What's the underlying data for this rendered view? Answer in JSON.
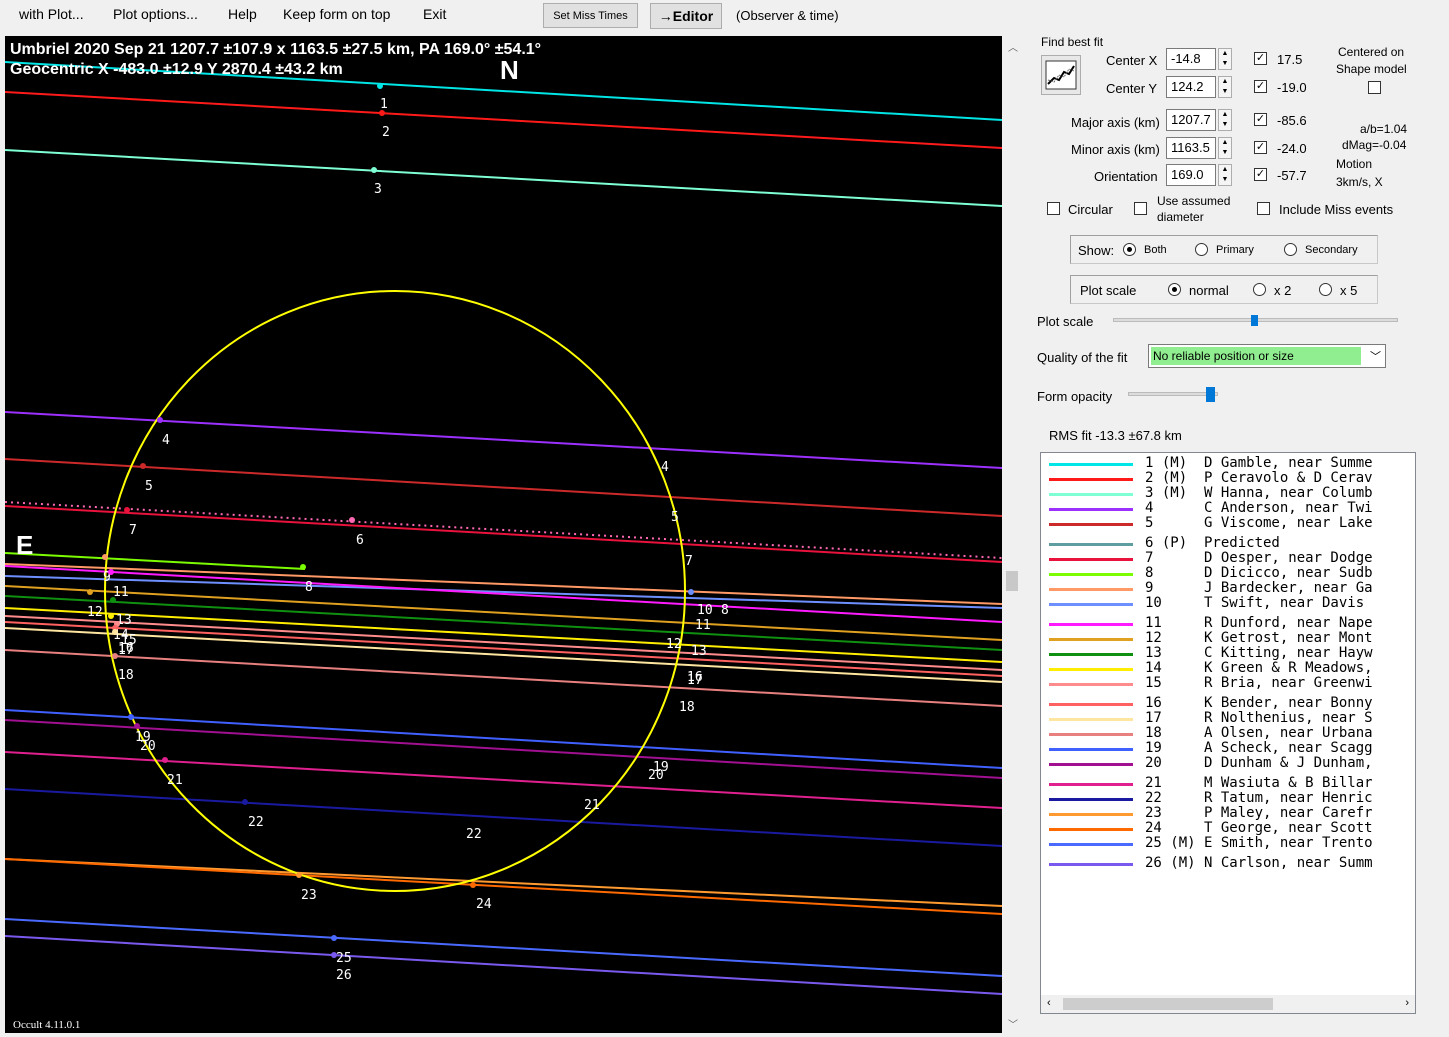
{
  "menu": {
    "with_plot": "with Plot...",
    "plot_options": "Plot options...",
    "help": "Help",
    "keep_on_top": "Keep form on top",
    "exit": "Exit",
    "set_miss_times": "Set Miss Times",
    "editor": "→Editor",
    "observer_time": "(Observer & time)"
  },
  "plot": {
    "title_line1": "Umbriel  2020 Sep 21   1207.7 ±107.9 x 1163.5 ±27.5 km, PA 169.0° ±54.1°",
    "title_line2": "Geocentric  X  -483.0 ±12.9  Y 2870.4 ±43.2 km",
    "north": "N",
    "east": "E",
    "version": "Occult 4.11.0.1",
    "ellipse_color": "#ffff00"
  },
  "chords": [
    {
      "n": "1",
      "color": "#00e5e5"
    },
    {
      "n": "2",
      "color": "#ff1a1a"
    },
    {
      "n": "3",
      "color": "#7fffd4"
    },
    {
      "n": "4",
      "color": "#9b30ff"
    },
    {
      "n": "5",
      "color": "#cc2a2a"
    },
    {
      "n": "6",
      "color": "#ff69b4"
    },
    {
      "n": "7",
      "color": "#e8123c"
    },
    {
      "n": "8",
      "color": "#7cfc00"
    },
    {
      "n": "9",
      "color": "#ff9966"
    },
    {
      "n": "10",
      "color": "#6e8fff"
    },
    {
      "n": "11",
      "color": "#ff1aff"
    },
    {
      "n": "12",
      "color": "#e0a020"
    },
    {
      "n": "13",
      "color": "#109010"
    },
    {
      "n": "14",
      "color": "#ffee00"
    },
    {
      "n": "15",
      "color": "#ff8c8c"
    },
    {
      "n": "16",
      "color": "#ff6060"
    },
    {
      "n": "17",
      "color": "#ffe6a0"
    },
    {
      "n": "18",
      "color": "#e88080"
    },
    {
      "n": "19",
      "color": "#4060ff"
    },
    {
      "n": "20",
      "color": "#a01090"
    },
    {
      "n": "21",
      "color": "#e0208f"
    },
    {
      "n": "22",
      "color": "#1a1aa0"
    },
    {
      "n": "23",
      "color": "#ff9a30"
    },
    {
      "n": "24",
      "color": "#ff6a00"
    },
    {
      "n": "25",
      "color": "#4a6aff"
    },
    {
      "n": "26",
      "color": "#7a5aee"
    }
  ],
  "panel": {
    "find_best_fit": "Find best fit",
    "center_x_label": "Center X",
    "center_x": "-14.8",
    "center_y_label": "Center Y",
    "center_y": "124.2",
    "major_label": "Major axis (km)",
    "major": "1207.7",
    "minor_label": "Minor axis (km)",
    "minor": "1163.5",
    "orient_label": "Orientation",
    "orient": "169.0",
    "chk_vals": [
      "17.5",
      "-19.0",
      "-85.6",
      "-24.0",
      "-57.7"
    ],
    "centered_on": "Centered on",
    "shape_model": "Shape model",
    "ab": "a/b=1.04",
    "dmag": "dMag=-0.04",
    "motion": "Motion",
    "motion_val": "3km/s, X",
    "circular": "Circular",
    "use_assumed": "Use assumed",
    "diameter": "diameter",
    "include_miss": "Include Miss events",
    "show": "Show:",
    "both": "Both",
    "primary": "Primary",
    "secondary": "Secondary",
    "plot_scale_group": "Plot scale",
    "normal": "normal",
    "x2": "x 2",
    "x5": "x 5",
    "plot_scale": "Plot scale",
    "quality_label": "Quality of the fit",
    "quality_value": "No reliable position or size",
    "form_opacity": "Form opacity",
    "rms": "RMS fit -13.3 ±67.8 km"
  },
  "legend": [
    {
      "text": "1 (M)  D Gamble, near Summe",
      "color": "#00e5e5"
    },
    {
      "text": "2 (M)  P Ceravolo & D Cerav",
      "color": "#ff1a1a"
    },
    {
      "text": "3 (M)  W Hanna, near Columb",
      "color": "#7fffd4"
    },
    {
      "text": "4      C Anderson, near Twi",
      "color": "#9b30ff"
    },
    {
      "text": "5      G Viscome, near Lake",
      "color": "#cc2a2a"
    },
    {
      "text": "6 (P)  Predicted",
      "color": "#5f9ea0"
    },
    {
      "text": "7      D Oesper, near Dodge",
      "color": "#e8123c"
    },
    {
      "text": "8      D Dicicco, near Sudb",
      "color": "#7cfc00"
    },
    {
      "text": "9      J Bardecker, near Ga",
      "color": "#ff9966"
    },
    {
      "text": "10     T Swift, near Davis",
      "color": "#6e8fff"
    },
    {
      "text": "11     R Dunford, near Nape",
      "color": "#ff1aff"
    },
    {
      "text": "12     K Getrost, near Mont",
      "color": "#e0a020"
    },
    {
      "text": "13     C Kitting, near Hayw",
      "color": "#109010"
    },
    {
      "text": "14     K Green & R Meadows,",
      "color": "#ffee00"
    },
    {
      "text": "15     R Bria, near Greenwi",
      "color": "#ff8c8c"
    },
    {
      "text": "16     K Bender, near Bonny",
      "color": "#ff6060"
    },
    {
      "text": "17     R Nolthenius, near S",
      "color": "#ffe6a0"
    },
    {
      "text": "18     A Olsen, near Urbana",
      "color": "#e88080"
    },
    {
      "text": "19     A Scheck, near Scagg",
      "color": "#4060ff"
    },
    {
      "text": "20     D Dunham & J Dunham,",
      "color": "#a01090"
    },
    {
      "text": "21     M Wasiuta & B Billar",
      "color": "#e0208f"
    },
    {
      "text": "22     R Tatum, near Henric",
      "color": "#1a1aa0"
    },
    {
      "text": "23     P Maley, near Carefr",
      "color": "#ff9a30"
    },
    {
      "text": "24     T George, near Scott",
      "color": "#ff6a00"
    },
    {
      "text": "25 (M) E Smith, near Trento",
      "color": "#4a6aff"
    },
    {
      "text": "26 (M) N Carlson, near Summ",
      "color": "#7a5aee"
    }
  ]
}
